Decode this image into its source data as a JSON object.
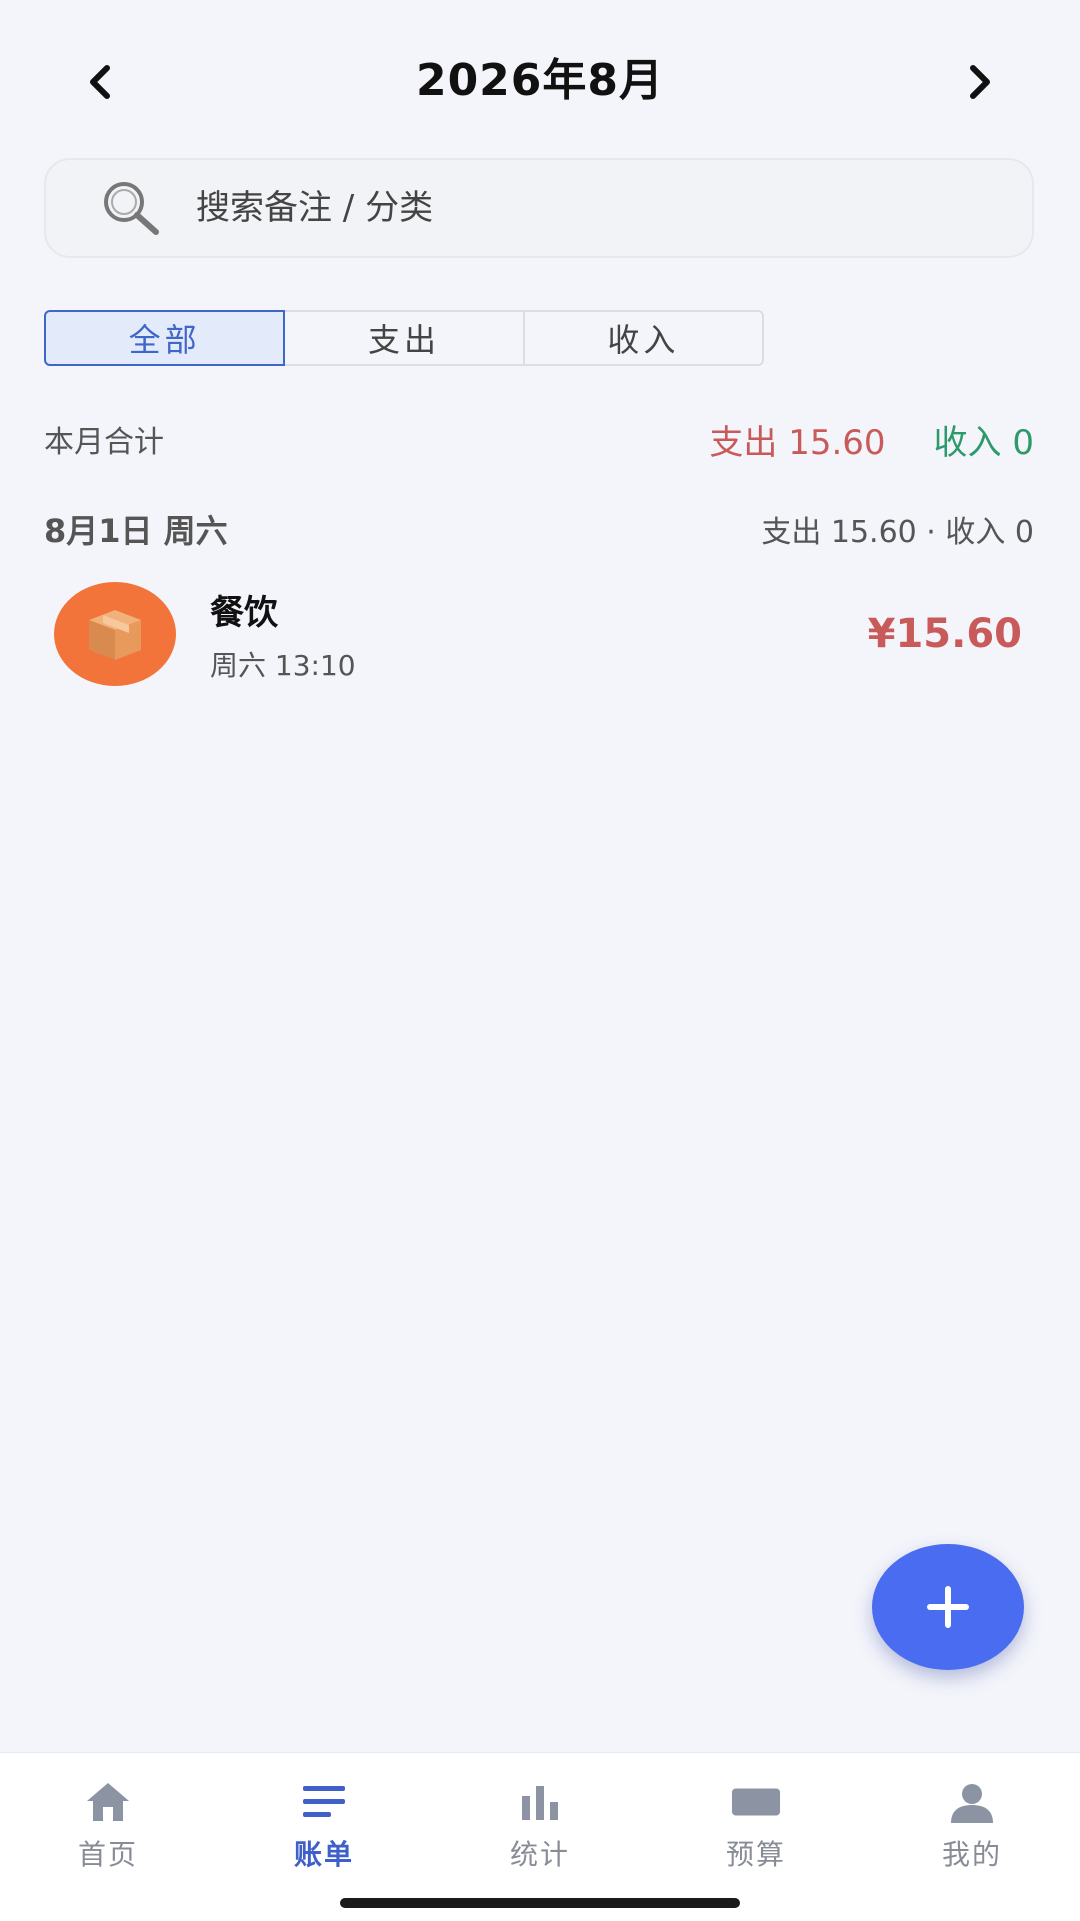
{
  "header": {
    "title": "2026年8月",
    "prev_icon": "chevron-left-icon",
    "next_icon": "chevron-right-icon"
  },
  "search": {
    "placeholder": "搜索备注 / 分类",
    "icon": "search-icon"
  },
  "filter_tabs": {
    "items": [
      "全部",
      "支出",
      "收入"
    ],
    "active": "全部"
  },
  "month_summary": {
    "label": "本月合计",
    "expense": "支出 15.60",
    "income": "收入 0"
  },
  "days": [
    {
      "date": "8月1日 周六",
      "totals": "支出 15.60 · 收入 0",
      "transactions": [
        {
          "category": "餐饮",
          "time": "周六 13:10",
          "amount": "¥15.60",
          "icon": "package-box-icon"
        }
      ]
    }
  ],
  "fab": {
    "label": "+",
    "icon": "plus-icon"
  },
  "bottom_nav": {
    "items": [
      {
        "label": "首页",
        "icon": "home-icon"
      },
      {
        "label": "账单",
        "icon": "list-icon"
      },
      {
        "label": "统计",
        "icon": "bar-chart-icon"
      },
      {
        "label": "预算",
        "icon": "wallet-icon"
      },
      {
        "label": "我的",
        "icon": "user-icon"
      }
    ],
    "active": "账单"
  },
  "colors": {
    "background": "#F4F5FB",
    "accent": "#3F66C9",
    "expense": "#C95A5A",
    "income": "#2E9A6C",
    "fab": "#4A6CF0",
    "category_orange": "#F2743A"
  }
}
